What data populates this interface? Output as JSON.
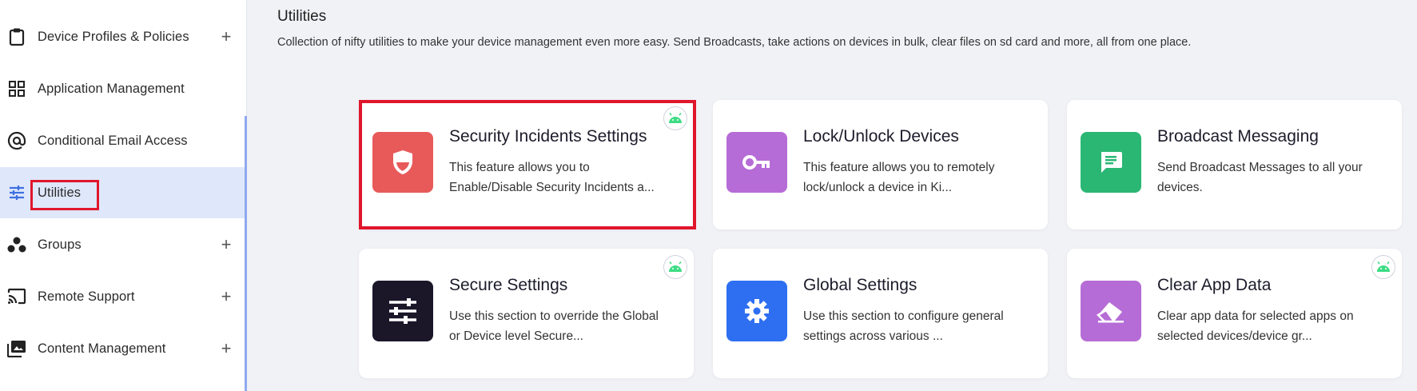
{
  "sidebar": {
    "items": [
      {
        "label": "Device Profiles & Policies",
        "icon": "clipboard-icon",
        "has_plus": true,
        "active": false
      },
      {
        "label": "Application Management",
        "icon": "grid-icon",
        "has_plus": false,
        "active": false
      },
      {
        "label": "Conditional Email Access",
        "icon": "at-sign-icon",
        "has_plus": false,
        "active": false
      },
      {
        "label": "Utilities",
        "icon": "sliders-icon",
        "has_plus": false,
        "active": true
      },
      {
        "label": "Groups",
        "icon": "groups-icon",
        "has_plus": true,
        "active": false
      },
      {
        "label": "Remote Support",
        "icon": "cast-icon",
        "has_plus": true,
        "active": false
      },
      {
        "label": "Content Management",
        "icon": "photo-library-icon",
        "has_plus": true,
        "active": false
      }
    ],
    "plus_symbol": "+"
  },
  "main": {
    "title": "Utilities",
    "description": "Collection of nifty utilities to make your device management even more easy. Send Broadcasts, take actions on devices in bulk, clear files on sd card and more, all from one place.",
    "cards": [
      {
        "title": "Security Incidents Settings",
        "desc_line1": "This feature allows you to",
        "desc_line2": "Enable/Disable Security Incidents a...",
        "icon": "shield-icon",
        "color": "#e85a5a",
        "android": true
      },
      {
        "title": "Lock/Unlock Devices",
        "desc_line1": "This feature allows you to remotely",
        "desc_line2": "lock/unlock a device in Ki...",
        "icon": "key-icon",
        "color": "#b66cd6",
        "android": false
      },
      {
        "title": "Broadcast Messaging",
        "desc_line1": "Send Broadcast Messages to all your",
        "desc_line2": "devices.",
        "icon": "message-icon",
        "color": "#2ab774",
        "android": false
      },
      {
        "title": "Secure Settings",
        "desc_line1": "Use this section to override the Global",
        "desc_line2": "or Device level Secure...",
        "icon": "sliders-icon",
        "color": "#1b1729",
        "android": true
      },
      {
        "title": "Global Settings",
        "desc_line1": "Use this section to configure general",
        "desc_line2": "settings across various ...",
        "icon": "gear-icon",
        "color": "#2e6ff2",
        "android": false
      },
      {
        "title": "Clear App Data",
        "desc_line1": "Clear app data for selected apps on",
        "desc_line2": "selected devices/device gr...",
        "icon": "eraser-icon",
        "color": "#b66cd6",
        "android": true
      }
    ]
  },
  "colors": {
    "highlight": "#e0162b",
    "active_nav_bg": "#dfe7fb",
    "android_green": "#3ddc84"
  }
}
